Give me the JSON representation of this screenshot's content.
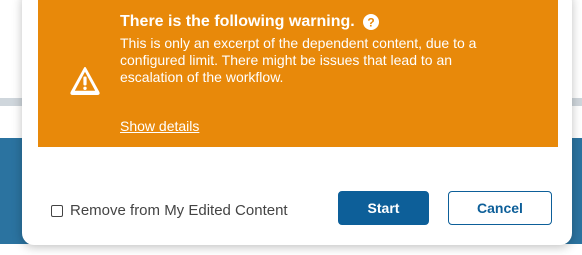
{
  "warning": {
    "title": "There is the following warning.",
    "body": "This is only an excerpt of the dependent content, due to a configured limit. There might be issues that lead to an escalation of the workflow.",
    "show_details_label": "Show details",
    "accent_color": "#e8890a"
  },
  "footer": {
    "checkbox_label": "Remove from My Edited Content",
    "checkbox_checked": false,
    "start_label": "Start",
    "cancel_label": "Cancel",
    "primary_color": "#0d5f99"
  },
  "icons": {
    "warning": "warning-triangle-icon",
    "help": "question-circle-icon",
    "scroll": "scroll-up-arrow-icon"
  }
}
